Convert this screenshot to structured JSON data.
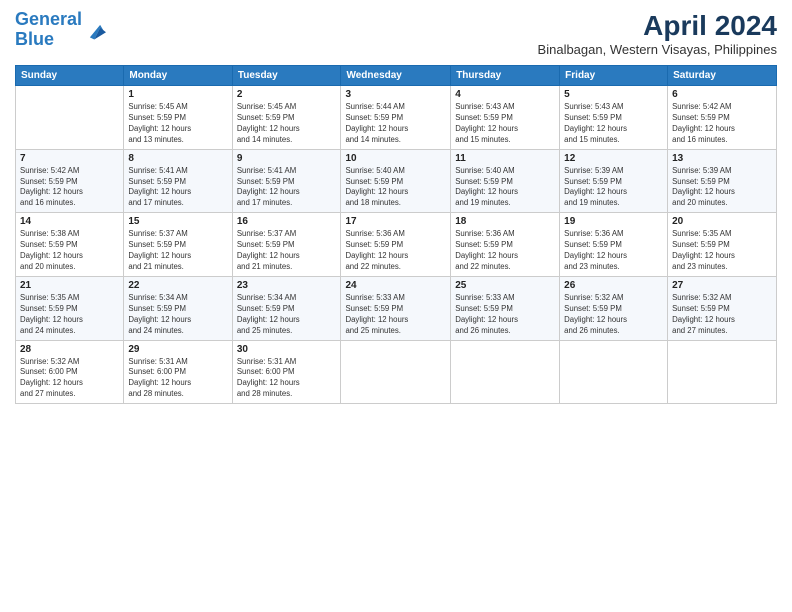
{
  "header": {
    "logo_line1": "General",
    "logo_line2": "Blue",
    "month_year": "April 2024",
    "location": "Binalbagan, Western Visayas, Philippines"
  },
  "weekdays": [
    "Sunday",
    "Monday",
    "Tuesday",
    "Wednesday",
    "Thursday",
    "Friday",
    "Saturday"
  ],
  "weeks": [
    [
      {
        "day": "",
        "info": ""
      },
      {
        "day": "1",
        "info": "Sunrise: 5:45 AM\nSunset: 5:59 PM\nDaylight: 12 hours\nand 13 minutes."
      },
      {
        "day": "2",
        "info": "Sunrise: 5:45 AM\nSunset: 5:59 PM\nDaylight: 12 hours\nand 14 minutes."
      },
      {
        "day": "3",
        "info": "Sunrise: 5:44 AM\nSunset: 5:59 PM\nDaylight: 12 hours\nand 14 minutes."
      },
      {
        "day": "4",
        "info": "Sunrise: 5:43 AM\nSunset: 5:59 PM\nDaylight: 12 hours\nand 15 minutes."
      },
      {
        "day": "5",
        "info": "Sunrise: 5:43 AM\nSunset: 5:59 PM\nDaylight: 12 hours\nand 15 minutes."
      },
      {
        "day": "6",
        "info": "Sunrise: 5:42 AM\nSunset: 5:59 PM\nDaylight: 12 hours\nand 16 minutes."
      }
    ],
    [
      {
        "day": "7",
        "info": "Sunrise: 5:42 AM\nSunset: 5:59 PM\nDaylight: 12 hours\nand 16 minutes."
      },
      {
        "day": "8",
        "info": "Sunrise: 5:41 AM\nSunset: 5:59 PM\nDaylight: 12 hours\nand 17 minutes."
      },
      {
        "day": "9",
        "info": "Sunrise: 5:41 AM\nSunset: 5:59 PM\nDaylight: 12 hours\nand 17 minutes."
      },
      {
        "day": "10",
        "info": "Sunrise: 5:40 AM\nSunset: 5:59 PM\nDaylight: 12 hours\nand 18 minutes."
      },
      {
        "day": "11",
        "info": "Sunrise: 5:40 AM\nSunset: 5:59 PM\nDaylight: 12 hours\nand 19 minutes."
      },
      {
        "day": "12",
        "info": "Sunrise: 5:39 AM\nSunset: 5:59 PM\nDaylight: 12 hours\nand 19 minutes."
      },
      {
        "day": "13",
        "info": "Sunrise: 5:39 AM\nSunset: 5:59 PM\nDaylight: 12 hours\nand 20 minutes."
      }
    ],
    [
      {
        "day": "14",
        "info": "Sunrise: 5:38 AM\nSunset: 5:59 PM\nDaylight: 12 hours\nand 20 minutes."
      },
      {
        "day": "15",
        "info": "Sunrise: 5:37 AM\nSunset: 5:59 PM\nDaylight: 12 hours\nand 21 minutes."
      },
      {
        "day": "16",
        "info": "Sunrise: 5:37 AM\nSunset: 5:59 PM\nDaylight: 12 hours\nand 21 minutes."
      },
      {
        "day": "17",
        "info": "Sunrise: 5:36 AM\nSunset: 5:59 PM\nDaylight: 12 hours\nand 22 minutes."
      },
      {
        "day": "18",
        "info": "Sunrise: 5:36 AM\nSunset: 5:59 PM\nDaylight: 12 hours\nand 22 minutes."
      },
      {
        "day": "19",
        "info": "Sunrise: 5:36 AM\nSunset: 5:59 PM\nDaylight: 12 hours\nand 23 minutes."
      },
      {
        "day": "20",
        "info": "Sunrise: 5:35 AM\nSunset: 5:59 PM\nDaylight: 12 hours\nand 23 minutes."
      }
    ],
    [
      {
        "day": "21",
        "info": "Sunrise: 5:35 AM\nSunset: 5:59 PM\nDaylight: 12 hours\nand 24 minutes."
      },
      {
        "day": "22",
        "info": "Sunrise: 5:34 AM\nSunset: 5:59 PM\nDaylight: 12 hours\nand 24 minutes."
      },
      {
        "day": "23",
        "info": "Sunrise: 5:34 AM\nSunset: 5:59 PM\nDaylight: 12 hours\nand 25 minutes."
      },
      {
        "day": "24",
        "info": "Sunrise: 5:33 AM\nSunset: 5:59 PM\nDaylight: 12 hours\nand 25 minutes."
      },
      {
        "day": "25",
        "info": "Sunrise: 5:33 AM\nSunset: 5:59 PM\nDaylight: 12 hours\nand 26 minutes."
      },
      {
        "day": "26",
        "info": "Sunrise: 5:32 AM\nSunset: 5:59 PM\nDaylight: 12 hours\nand 26 minutes."
      },
      {
        "day": "27",
        "info": "Sunrise: 5:32 AM\nSunset: 5:59 PM\nDaylight: 12 hours\nand 27 minutes."
      }
    ],
    [
      {
        "day": "28",
        "info": "Sunrise: 5:32 AM\nSunset: 6:00 PM\nDaylight: 12 hours\nand 27 minutes."
      },
      {
        "day": "29",
        "info": "Sunrise: 5:31 AM\nSunset: 6:00 PM\nDaylight: 12 hours\nand 28 minutes."
      },
      {
        "day": "30",
        "info": "Sunrise: 5:31 AM\nSunset: 6:00 PM\nDaylight: 12 hours\nand 28 minutes."
      },
      {
        "day": "",
        "info": ""
      },
      {
        "day": "",
        "info": ""
      },
      {
        "day": "",
        "info": ""
      },
      {
        "day": "",
        "info": ""
      }
    ]
  ]
}
